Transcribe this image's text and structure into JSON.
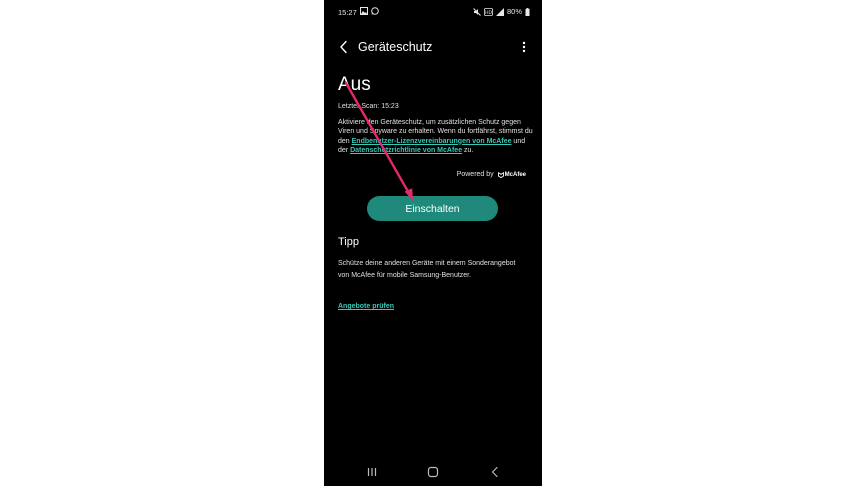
{
  "status_bar": {
    "time": "15:27",
    "battery": "80%",
    "left_icons": [
      "image-icon",
      "whatsapp-icon"
    ],
    "right_icons": [
      "mute-icon",
      "hd-icon",
      "signal-icon",
      "battery-icon"
    ]
  },
  "app_bar": {
    "title": "Geräteschutz",
    "back_icon": "chevron-left-icon",
    "menu_icon": "more-vertical-icon"
  },
  "protection": {
    "state": "Aus",
    "last_scan": "Letzter Scan: 15:23",
    "description_1": "Aktiviere den Geräteschutz, um zusätzlichen Schutz gegen Viren und Spyware zu erhalten. Wenn du fortfährst, stimmst du den ",
    "eula_link": "Endbenutzer-Lizenzvereinbarungen von McAfee",
    "description_2": " und der ",
    "privacy_link": "Datenschutzrichtlinie von McAfee",
    "description_3": " zu.",
    "powered_by": "Powered by",
    "powered_brand": "McAfee",
    "turn_on_label": "Einschalten"
  },
  "tip": {
    "heading": "Tipp",
    "text": "Schütze deine anderen Geräte mit einem Sonderangebot von McAfee für mobile Samsung-Benutzer.",
    "link": "Angebote prüfen"
  },
  "nav_bar": {
    "icons": [
      "recents-icon",
      "home-icon",
      "back-icon"
    ]
  },
  "colors": {
    "background": "#000000",
    "accent_button": "#1f8a7c",
    "link": "#35c9b8",
    "annotation_arrow": "#e8266a"
  }
}
